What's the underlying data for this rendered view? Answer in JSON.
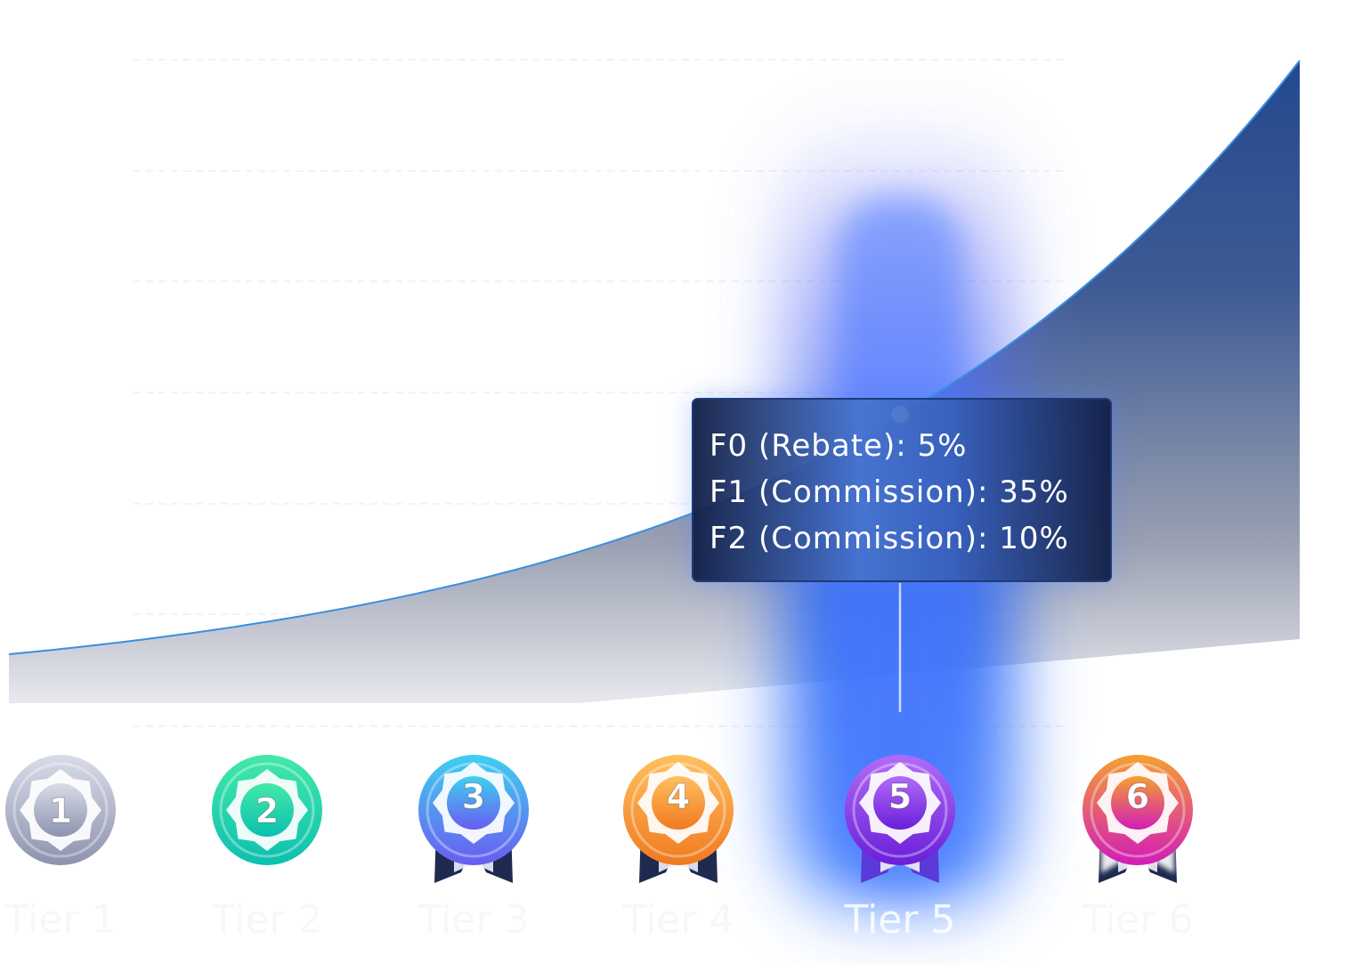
{
  "chart_data": {
    "type": "area",
    "categories": [
      "Tier 1",
      "Tier 2",
      "Tier 3",
      "Tier 4",
      "Tier 5",
      "Tier 6"
    ],
    "highlighted_category": "Tier 5",
    "tooltip": {
      "lines": [
        "F0 (Rebate): 5%",
        "F1 (Commission): 35%",
        "F2 (Commission): 10%"
      ]
    },
    "grid": "horizontal-dashed",
    "legend": "none"
  },
  "badges": [
    {
      "number": "1",
      "colors": [
        "#d9dce8",
        "#8d93ae"
      ],
      "ribbon": false
    },
    {
      "number": "2",
      "colors": [
        "#44e8a8",
        "#0cc0b0"
      ],
      "ribbon": false
    },
    {
      "number": "3",
      "colors": [
        "#3ed0f0",
        "#6a5cf0"
      ],
      "ribbon": true
    },
    {
      "number": "4",
      "colors": [
        "#ffc060",
        "#f07a20"
      ],
      "ribbon": true
    },
    {
      "number": "5",
      "colors": [
        "#b26cf8",
        "#6a1ed8"
      ],
      "ribbon": true
    },
    {
      "number": "6",
      "colors": [
        "#f6a030",
        "#d21cb8"
      ],
      "ribbon": true
    }
  ],
  "colors": {
    "curve": "#3a8fe0",
    "area_top": "#24498f",
    "area_bottom": "#c8cbd4",
    "highlight_glow": "#2c64ff",
    "tooltip_bg": "#122048"
  }
}
